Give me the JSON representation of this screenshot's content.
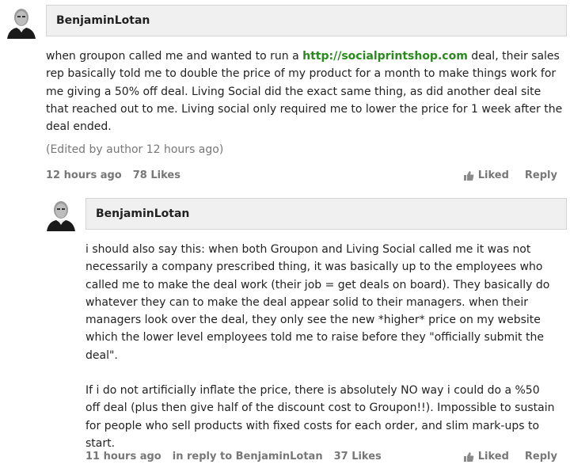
{
  "comments": [
    {
      "author": "BenjaminLotan",
      "body_parts": {
        "before_link": "when groupon called me and wanted to run a ",
        "link": "http://socialprintshop.com",
        "after_link": " deal, their sales rep basically told me to double the price of my product for a month to make things work for me giving a 50% off deal. Living Social did the exact same thing, as did another deal site that reached out to me. Living social only required me to lower the price for 1 week after the deal ended."
      },
      "edited": "(Edited by author 12 hours ago)",
      "time": "12 hours ago",
      "likes": "78 Likes",
      "liked_label": "Liked",
      "reply_label": "Reply"
    },
    {
      "author": "BenjaminLotan",
      "paragraph1": "i should also say this: when both Groupon and Living Social called me it was not necessarily a company prescribed thing, it was basically up to the employees who called me to make the deal work (their job = get deals on board). They basically do whatever they can to make the deal appear solid to their managers. when their managers look over the deal, they only see the new *higher* price on my website which the lower level employees told me to raise before they \"officially submit the deal\".",
      "paragraph2": "If i do not artificially inflate the price, there is absolutely NO way i could do a %50 off deal (plus then give half of the discount cost to Groupon!!). Impossible to sustain for people who sell products with fixed costs for each order, and slim mark-ups to start.",
      "time": "11 hours ago",
      "in_reply_to": "in reply to BenjaminLotan",
      "likes": "37 Likes",
      "liked_label": "Liked",
      "reply_label": "Reply"
    }
  ],
  "icons": {
    "like": "thumbs-up-icon",
    "avatar": "user-avatar"
  },
  "colors": {
    "link": "#2b8a1e",
    "meta": "#777777",
    "author_bar": "#f0f0f0"
  }
}
